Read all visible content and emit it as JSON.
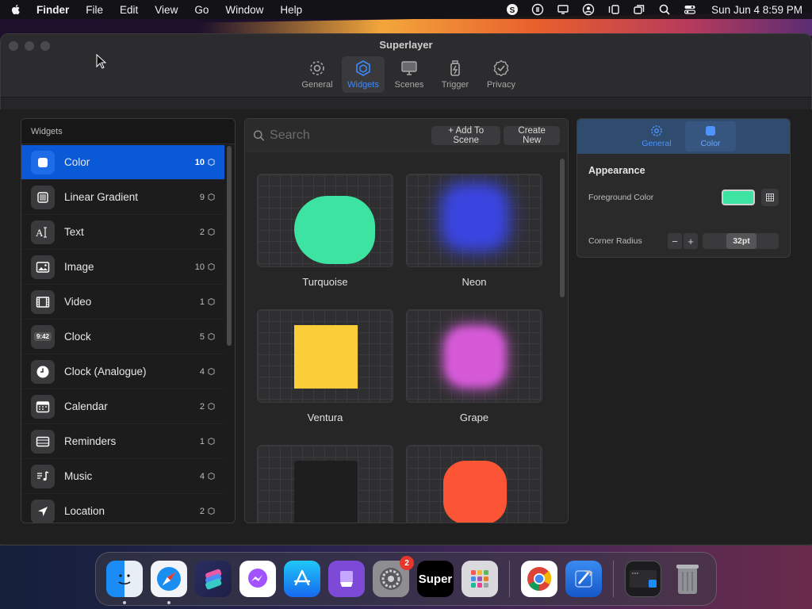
{
  "menubar": {
    "app_name": "Finder",
    "menus": [
      "File",
      "Edit",
      "View",
      "Go",
      "Window",
      "Help"
    ],
    "clock": "Sun Jun 4  8:59 PM"
  },
  "window": {
    "title": "Superlayer",
    "toolbar": [
      {
        "label": "General",
        "icon": "gear-icon",
        "active": false
      },
      {
        "label": "Widgets",
        "icon": "widgets-icon",
        "active": true
      },
      {
        "label": "Scenes",
        "icon": "monitor-icon",
        "active": false
      },
      {
        "label": "Trigger",
        "icon": "trigger-icon",
        "active": false
      },
      {
        "label": "Privacy",
        "icon": "check-badge-icon",
        "active": false
      }
    ]
  },
  "sidebar": {
    "header": "Widgets",
    "items": [
      {
        "label": "Color",
        "count": "10",
        "icon": "square-icon",
        "active": true
      },
      {
        "label": "Linear Gradient",
        "count": "9",
        "icon": "gradient-icon"
      },
      {
        "label": "Text",
        "count": "2",
        "icon": "text-icon"
      },
      {
        "label": "Image",
        "count": "10",
        "icon": "image-icon"
      },
      {
        "label": "Video",
        "count": "1",
        "icon": "film-icon"
      },
      {
        "label": "Clock",
        "count": "5",
        "icon": "digital-clock-icon",
        "icon_text": "9:42"
      },
      {
        "label": "Clock (Analogue)",
        "count": "4",
        "icon": "clock-icon"
      },
      {
        "label": "Calendar",
        "count": "2",
        "icon": "calendar-icon"
      },
      {
        "label": "Reminders",
        "count": "1",
        "icon": "reminders-icon"
      },
      {
        "label": "Music",
        "count": "4",
        "icon": "music-icon"
      },
      {
        "label": "Location",
        "count": "2",
        "icon": "location-arrow-icon"
      }
    ]
  },
  "grid": {
    "search_placeholder": "Search",
    "add_to_scene_label": "+ Add To Scene",
    "create_new_label": "Create New",
    "tiles": [
      {
        "label": "Turquoise",
        "color": "#3de3a0"
      },
      {
        "label": "Neon",
        "color": "#3a45e0"
      },
      {
        "label": "Ventura",
        "color": "#fbcd38"
      },
      {
        "label": "Grape",
        "color": "#d65ad8"
      },
      {
        "label": "",
        "color": "#1e1e1f"
      },
      {
        "label": "",
        "color": "#fb5535"
      }
    ]
  },
  "inspector": {
    "tabs": [
      {
        "label": "General",
        "active": false
      },
      {
        "label": "Color",
        "active": true
      }
    ],
    "heading": "Appearance",
    "foreground_label": "Foreground Color",
    "foreground_color": "#3de3a0",
    "corner_radius_label": "Corner Radius",
    "corner_radius_value": "32pt",
    "stepper_minus": "−",
    "stepper_plus": "+"
  },
  "dock": {
    "apps": [
      "Finder",
      "Safari",
      "Shortcuts",
      "Messenger",
      "App Store",
      "Podcasts Archive",
      "System Settings",
      "Super",
      "Launchpad",
      "Chrome",
      "Xcode",
      "Terminal Finder",
      "Trash"
    ],
    "system_settings_badge": "2",
    "super_label": "Super"
  }
}
